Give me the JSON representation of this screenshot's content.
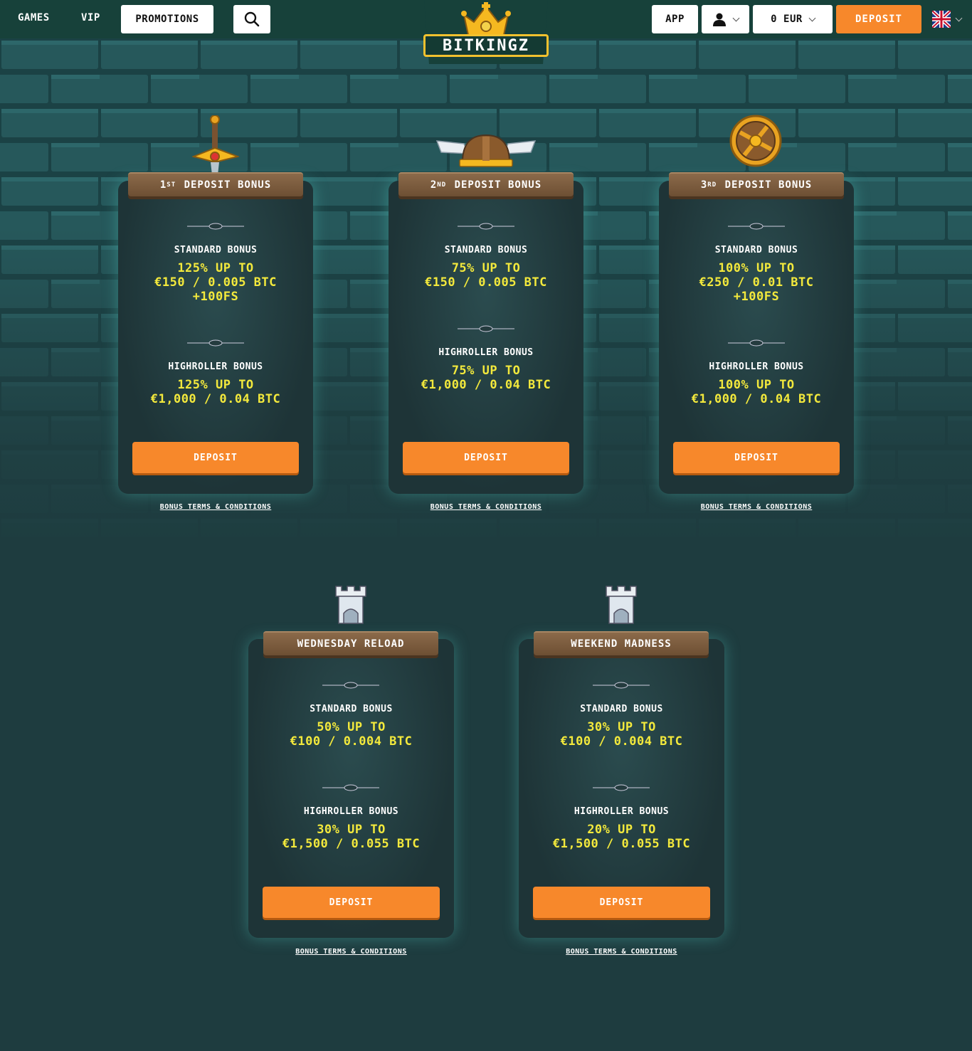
{
  "header": {
    "nav": [
      "GAMES",
      "VIP",
      "PROMOTIONS"
    ],
    "app_label": "APP",
    "balance": "0 EUR",
    "deposit_label": "DEPOSIT",
    "logo_text": "BITKINGZ"
  },
  "cards": [
    {
      "title_pre": "1",
      "title_sup": "ST",
      "title_post": "DEPOSIT BONUS",
      "standard_label": "STANDARD BONUS",
      "standard_lines": [
        "125% UP TO",
        "€150 / 0.005 BTC",
        "+100FS"
      ],
      "highroller_label": "HIGHROLLER BONUS",
      "highroller_lines": [
        "125% UP TO",
        "€1,000 / 0.04 BTC"
      ],
      "button": "DEPOSIT",
      "terms": "BONUS TERMS & CONDITIONS",
      "icon": "sword-icon"
    },
    {
      "title_pre": "2",
      "title_sup": "ND",
      "title_post": "DEPOSIT BONUS",
      "standard_label": "STANDARD BONUS",
      "standard_lines": [
        "75% UP TO",
        "€150 / 0.005 BTC"
      ],
      "highroller_label": "HIGHROLLER BONUS",
      "highroller_lines": [
        "75% UP TO",
        "€1,000 / 0.04 BTC"
      ],
      "button": "DEPOSIT",
      "terms": "BONUS TERMS & CONDITIONS",
      "icon": "viking-helmet-icon"
    },
    {
      "title_pre": "3",
      "title_sup": "RD",
      "title_post": "DEPOSIT BONUS",
      "standard_label": "STANDARD BONUS",
      "standard_lines": [
        "100% UP TO",
        "€250 / 0.01 BTC",
        "+100FS"
      ],
      "highroller_label": "HIGHROLLER BONUS",
      "highroller_lines": [
        "100% UP TO",
        "€1,000 / 0.04 BTC"
      ],
      "button": "DEPOSIT",
      "terms": "BONUS TERMS & CONDITIONS",
      "icon": "shield-icon"
    },
    {
      "title_pre": "",
      "title_sup": "",
      "title_post": "WEDNESDAY RELOAD",
      "standard_label": "STANDARD BONUS",
      "standard_lines": [
        "50% UP TO",
        "€100 / 0.004 BTC"
      ],
      "highroller_label": "HIGHROLLER BONUS",
      "highroller_lines": [
        "30% UP TO",
        "€1,500 / 0.055 BTC"
      ],
      "button": "DEPOSIT",
      "terms": "BONUS TERMS & CONDITIONS",
      "icon": "castle-tower-icon"
    },
    {
      "title_pre": "",
      "title_sup": "",
      "title_post": "WEEKEND MADNESS",
      "standard_label": "STANDARD BONUS",
      "standard_lines": [
        "30% UP TO",
        "€100 / 0.004 BTC"
      ],
      "highroller_label": "HIGHROLLER BONUS",
      "highroller_lines": [
        "20% UP TO",
        "€1,500 / 0.055 BTC"
      ],
      "button": "DEPOSIT",
      "terms": "BONUS TERMS & CONDITIONS",
      "icon": "castle-tower-icon"
    }
  ],
  "colors": {
    "accent": "#f7882b",
    "amount": "#f3e93c",
    "background": "#1e3c3f",
    "header": "#17413a"
  }
}
